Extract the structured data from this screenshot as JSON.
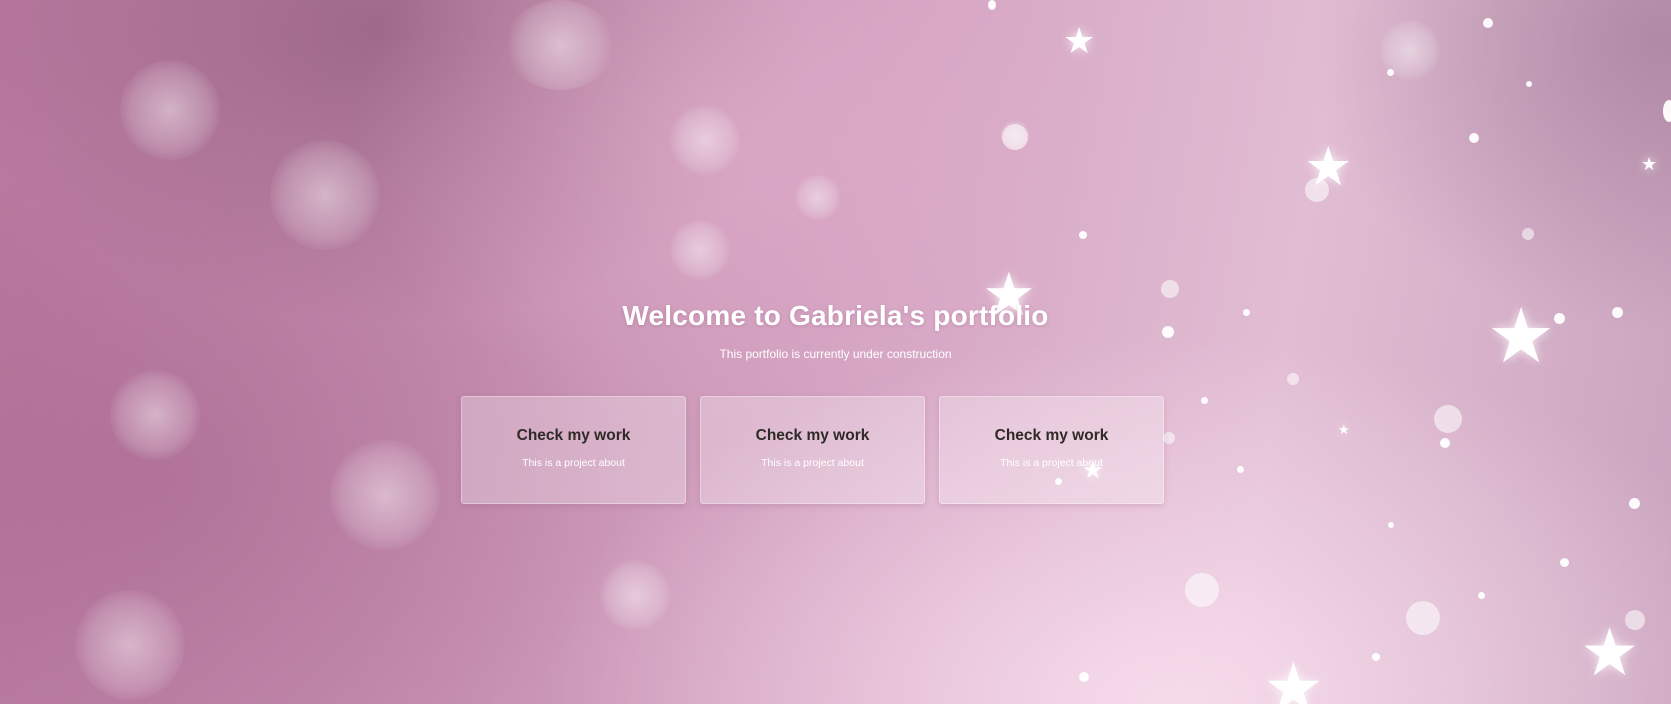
{
  "hero": {
    "title": "Welcome to Gabriela's portfolio",
    "subtitle": "This portfolio is currently under construction"
  },
  "cards": [
    {
      "title": "Check my work",
      "description": "This is a project about"
    },
    {
      "title": "Check my work",
      "description": "This is a project about"
    },
    {
      "title": "Check my work",
      "description": "This is a project about"
    }
  ],
  "colors": {
    "background": "#c58eb0",
    "card_title": "#2e2a26",
    "text": "#ffffff"
  },
  "icons": [
    "star-icon"
  ]
}
